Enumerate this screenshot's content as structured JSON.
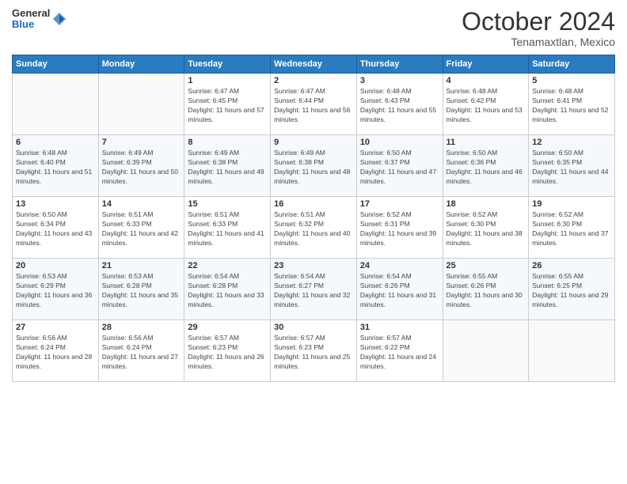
{
  "logo": {
    "general": "General",
    "blue": "Blue"
  },
  "title": "October 2024",
  "location": "Tenamaxtlan, Mexico",
  "days_of_week": [
    "Sunday",
    "Monday",
    "Tuesday",
    "Wednesday",
    "Thursday",
    "Friday",
    "Saturday"
  ],
  "weeks": [
    [
      {
        "day": "",
        "sunrise": "",
        "sunset": "",
        "daylight": ""
      },
      {
        "day": "",
        "sunrise": "",
        "sunset": "",
        "daylight": ""
      },
      {
        "day": "1",
        "sunrise": "Sunrise: 6:47 AM",
        "sunset": "Sunset: 6:45 PM",
        "daylight": "Daylight: 11 hours and 57 minutes."
      },
      {
        "day": "2",
        "sunrise": "Sunrise: 6:47 AM",
        "sunset": "Sunset: 6:44 PM",
        "daylight": "Daylight: 11 hours and 56 minutes."
      },
      {
        "day": "3",
        "sunrise": "Sunrise: 6:48 AM",
        "sunset": "Sunset: 6:43 PM",
        "daylight": "Daylight: 11 hours and 55 minutes."
      },
      {
        "day": "4",
        "sunrise": "Sunrise: 6:48 AM",
        "sunset": "Sunset: 6:42 PM",
        "daylight": "Daylight: 11 hours and 53 minutes."
      },
      {
        "day": "5",
        "sunrise": "Sunrise: 6:48 AM",
        "sunset": "Sunset: 6:41 PM",
        "daylight": "Daylight: 11 hours and 52 minutes."
      }
    ],
    [
      {
        "day": "6",
        "sunrise": "Sunrise: 6:48 AM",
        "sunset": "Sunset: 6:40 PM",
        "daylight": "Daylight: 11 hours and 51 minutes."
      },
      {
        "day": "7",
        "sunrise": "Sunrise: 6:49 AM",
        "sunset": "Sunset: 6:39 PM",
        "daylight": "Daylight: 11 hours and 50 minutes."
      },
      {
        "day": "8",
        "sunrise": "Sunrise: 6:49 AM",
        "sunset": "Sunset: 6:38 PM",
        "daylight": "Daylight: 11 hours and 49 minutes."
      },
      {
        "day": "9",
        "sunrise": "Sunrise: 6:49 AM",
        "sunset": "Sunset: 6:38 PM",
        "daylight": "Daylight: 11 hours and 48 minutes."
      },
      {
        "day": "10",
        "sunrise": "Sunrise: 6:50 AM",
        "sunset": "Sunset: 6:37 PM",
        "daylight": "Daylight: 11 hours and 47 minutes."
      },
      {
        "day": "11",
        "sunrise": "Sunrise: 6:50 AM",
        "sunset": "Sunset: 6:36 PM",
        "daylight": "Daylight: 11 hours and 46 minutes."
      },
      {
        "day": "12",
        "sunrise": "Sunrise: 6:50 AM",
        "sunset": "Sunset: 6:35 PM",
        "daylight": "Daylight: 11 hours and 44 minutes."
      }
    ],
    [
      {
        "day": "13",
        "sunrise": "Sunrise: 6:50 AM",
        "sunset": "Sunset: 6:34 PM",
        "daylight": "Daylight: 11 hours and 43 minutes."
      },
      {
        "day": "14",
        "sunrise": "Sunrise: 6:51 AM",
        "sunset": "Sunset: 6:33 PM",
        "daylight": "Daylight: 11 hours and 42 minutes."
      },
      {
        "day": "15",
        "sunrise": "Sunrise: 6:51 AM",
        "sunset": "Sunset: 6:33 PM",
        "daylight": "Daylight: 11 hours and 41 minutes."
      },
      {
        "day": "16",
        "sunrise": "Sunrise: 6:51 AM",
        "sunset": "Sunset: 6:32 PM",
        "daylight": "Daylight: 11 hours and 40 minutes."
      },
      {
        "day": "17",
        "sunrise": "Sunrise: 6:52 AM",
        "sunset": "Sunset: 6:31 PM",
        "daylight": "Daylight: 11 hours and 39 minutes."
      },
      {
        "day": "18",
        "sunrise": "Sunrise: 6:52 AM",
        "sunset": "Sunset: 6:30 PM",
        "daylight": "Daylight: 11 hours and 38 minutes."
      },
      {
        "day": "19",
        "sunrise": "Sunrise: 6:52 AM",
        "sunset": "Sunset: 6:30 PM",
        "daylight": "Daylight: 11 hours and 37 minutes."
      }
    ],
    [
      {
        "day": "20",
        "sunrise": "Sunrise: 6:53 AM",
        "sunset": "Sunset: 6:29 PM",
        "daylight": "Daylight: 11 hours and 36 minutes."
      },
      {
        "day": "21",
        "sunrise": "Sunrise: 6:53 AM",
        "sunset": "Sunset: 6:28 PM",
        "daylight": "Daylight: 11 hours and 35 minutes."
      },
      {
        "day": "22",
        "sunrise": "Sunrise: 6:54 AM",
        "sunset": "Sunset: 6:28 PM",
        "daylight": "Daylight: 11 hours and 33 minutes."
      },
      {
        "day": "23",
        "sunrise": "Sunrise: 6:54 AM",
        "sunset": "Sunset: 6:27 PM",
        "daylight": "Daylight: 11 hours and 32 minutes."
      },
      {
        "day": "24",
        "sunrise": "Sunrise: 6:54 AM",
        "sunset": "Sunset: 6:26 PM",
        "daylight": "Daylight: 11 hours and 31 minutes."
      },
      {
        "day": "25",
        "sunrise": "Sunrise: 6:55 AM",
        "sunset": "Sunset: 6:26 PM",
        "daylight": "Daylight: 11 hours and 30 minutes."
      },
      {
        "day": "26",
        "sunrise": "Sunrise: 6:55 AM",
        "sunset": "Sunset: 6:25 PM",
        "daylight": "Daylight: 11 hours and 29 minutes."
      }
    ],
    [
      {
        "day": "27",
        "sunrise": "Sunrise: 6:56 AM",
        "sunset": "Sunset: 6:24 PM",
        "daylight": "Daylight: 11 hours and 28 minutes."
      },
      {
        "day": "28",
        "sunrise": "Sunrise: 6:56 AM",
        "sunset": "Sunset: 6:24 PM",
        "daylight": "Daylight: 11 hours and 27 minutes."
      },
      {
        "day": "29",
        "sunrise": "Sunrise: 6:57 AM",
        "sunset": "Sunset: 6:23 PM",
        "daylight": "Daylight: 11 hours and 26 minutes."
      },
      {
        "day": "30",
        "sunrise": "Sunrise: 6:57 AM",
        "sunset": "Sunset: 6:23 PM",
        "daylight": "Daylight: 11 hours and 25 minutes."
      },
      {
        "day": "31",
        "sunrise": "Sunrise: 6:57 AM",
        "sunset": "Sunset: 6:22 PM",
        "daylight": "Daylight: 11 hours and 24 minutes."
      },
      {
        "day": "",
        "sunrise": "",
        "sunset": "",
        "daylight": ""
      },
      {
        "day": "",
        "sunrise": "",
        "sunset": "",
        "daylight": ""
      }
    ]
  ]
}
